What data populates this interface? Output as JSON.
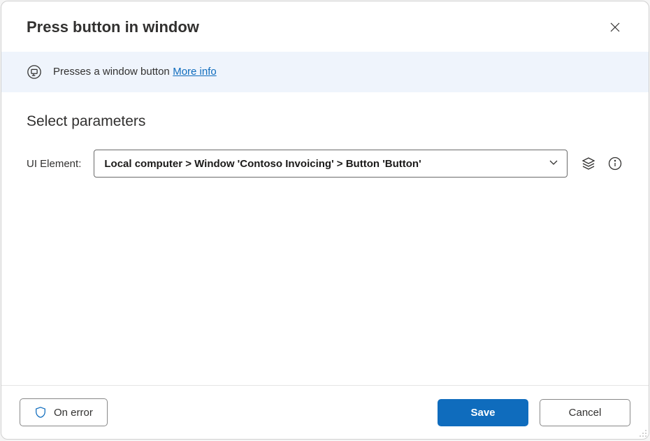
{
  "dialog": {
    "title": "Press button in window"
  },
  "banner": {
    "description": "Presses a window button",
    "more_info_label": "More info"
  },
  "params": {
    "section_title": "Select parameters",
    "ui_element": {
      "label": "UI Element:",
      "value": "Local computer > Window 'Contoso Invoicing' > Button 'Button'"
    }
  },
  "footer": {
    "on_error_label": "On error",
    "save_label": "Save",
    "cancel_label": "Cancel"
  }
}
